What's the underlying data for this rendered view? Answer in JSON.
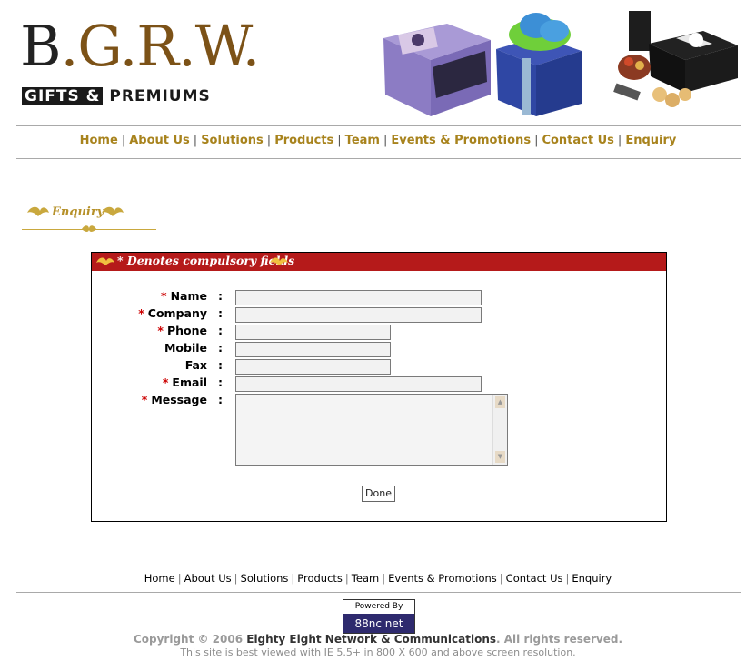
{
  "logo": {
    "letters": "B.G.R.W.",
    "subtitle_part1": "GIFTS &",
    "subtitle_part2": "PREMIUMS"
  },
  "colors": {
    "nav_gold": "#a8831d",
    "panel_red": "#b51a1a",
    "required_star": "#c00000",
    "heading_gold": "#b6912a"
  },
  "topnav": {
    "items": [
      "Home",
      "About Us",
      "Solutions",
      "Products",
      "Team",
      "Events & Promotions",
      "Contact Us",
      "Enquiry"
    ]
  },
  "page_heading": "Enquiry",
  "form": {
    "notice": "* Denotes compulsory fields",
    "fields": [
      {
        "label": "Name",
        "required": true,
        "value": ""
      },
      {
        "label": "Company",
        "required": true,
        "value": ""
      },
      {
        "label": "Phone",
        "required": true,
        "value": ""
      },
      {
        "label": "Mobile",
        "required": false,
        "value": ""
      },
      {
        "label": "Fax",
        "required": false,
        "value": ""
      },
      {
        "label": "Email",
        "required": true,
        "value": ""
      },
      {
        "label": "Message",
        "required": true,
        "value": ""
      }
    ],
    "required_marker": "*",
    "colon": ":",
    "submit_label": "Done"
  },
  "footer": {
    "nav": [
      "Home",
      "About Us",
      "Solutions",
      "Products",
      "Team",
      "Events & Promotions",
      "Contact Us",
      "Enquiry"
    ],
    "powered_by": "Powered By",
    "powered_logo": "88nc net",
    "copyright_prefix": "Copyright © 2006 ",
    "company": "Eighty Eight Network & Communications",
    "copyright_suffix": ". All rights reserved.",
    "resolution_note": "This site is best viewed with IE 5.5+ in 800 X 600 and above screen resolution."
  }
}
